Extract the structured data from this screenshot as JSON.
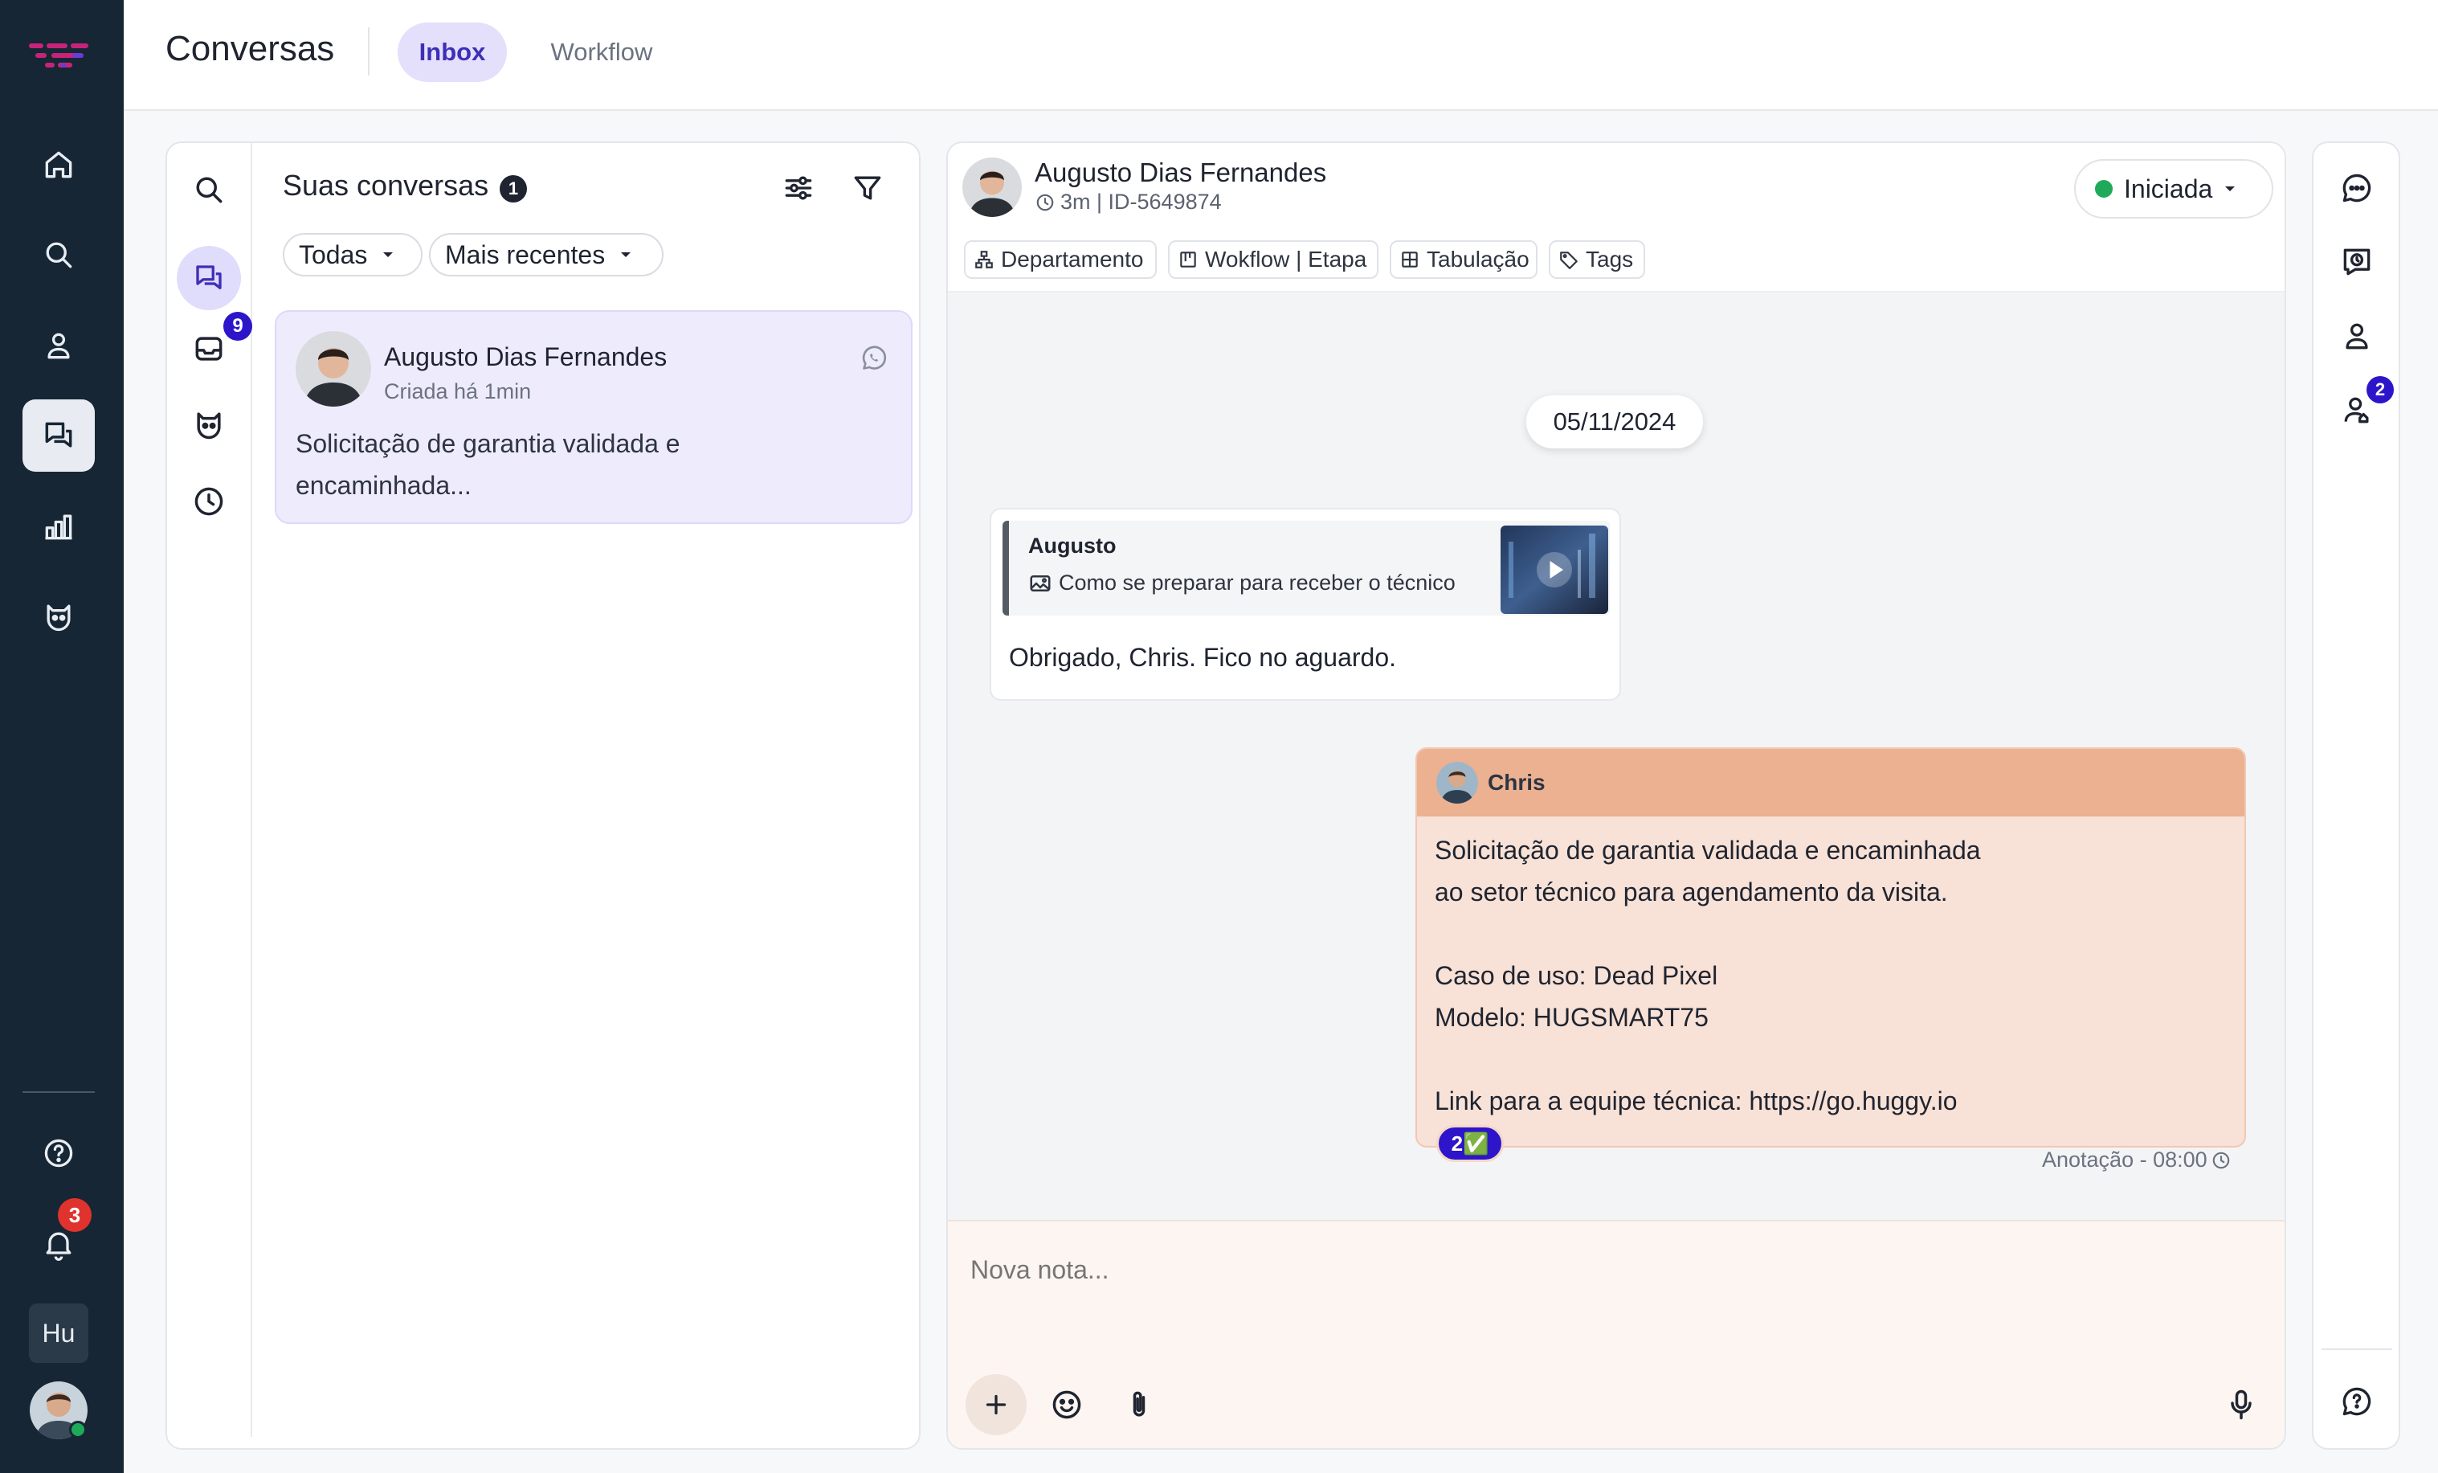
{
  "header": {
    "title": "Conversas",
    "tabs": [
      {
        "label": "Inbox",
        "active": true
      },
      {
        "label": "Workflow",
        "active": false
      }
    ]
  },
  "rail": {
    "notifications_count": "3",
    "workspace_initials": "Hu",
    "items": [
      "home-icon",
      "search-icon",
      "contacts-icon",
      "conversations-icon",
      "reports-icon",
      "bot-icon"
    ]
  },
  "subnav": {
    "inbox_badge": "9"
  },
  "conversation_list": {
    "title": "Suas conversas",
    "count": "1",
    "filter_all": "Todas",
    "filter_sort": "Mais recentes",
    "items": [
      {
        "name": "Augusto Dias Fernandes",
        "meta": "Criada há 1min",
        "preview_line1": "Solicitação de garantia validada e",
        "preview_line2": "encaminhada..."
      }
    ]
  },
  "chat": {
    "contact_name": "Augusto Dias Fernandes",
    "contact_meta": "3m | ID-5649874",
    "status": "Iniciada",
    "tags": [
      "Departamento",
      "Wokflow | Etapa",
      "Tabulação",
      "Tags"
    ],
    "date_divider": "05/11/2024",
    "incoming": {
      "reply_author": "Augusto",
      "reply_text": "Como se preparar para receber o técnico",
      "text": "Obrigado, Chris. Fico no aguardo."
    },
    "note": {
      "author": "Chris",
      "lines": [
        "Solicitação de garantia validada e encaminhada",
        "ao setor técnico para agendamento da visita.",
        "",
        "Caso de uso: Dead Pixel",
        "Modelo: HUGSMART75",
        "",
        "Link para a equipe técnica: https://go.huggy.io"
      ],
      "reaction": "2✅",
      "footer": "Anotação - 08:00"
    },
    "composer_placeholder": "Nova nota..."
  },
  "right_rail": {
    "badge": "2"
  },
  "colors": {
    "rail_bg": "#172634",
    "accent": "#5b3fd6",
    "status_green": "#1faa59",
    "note_header": "#ebb191",
    "note_body": "#f8e1d6",
    "composer_bg": "#fdf5f1"
  }
}
